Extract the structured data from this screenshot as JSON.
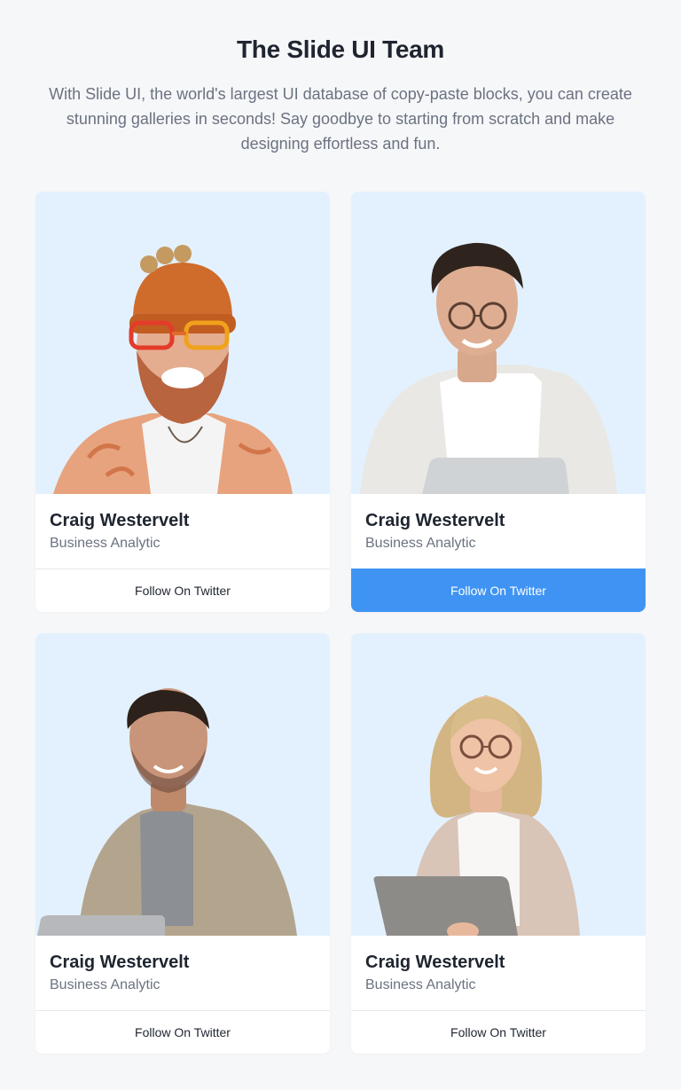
{
  "header": {
    "title": "The Slide UI Team",
    "subtitle": "With Slide UI, the world's largest UI database of copy-paste blocks, you can create stunning galleries in seconds! Say goodbye to starting from scratch and make designing effortless and fun."
  },
  "colors": {
    "page_background": "#f6f7f9",
    "photo_background": "#e3f1ff",
    "accent": "#3f94f3",
    "name_text": "#1f2530",
    "muted_text": "#6b7280"
  },
  "team": [
    {
      "name": "Craig Westervelt",
      "role": "Business Analytic",
      "button_label": "Follow On Twitter",
      "button_active": false,
      "photo": "man-beanie-orange-glasses-photo"
    },
    {
      "name": "Craig Westervelt",
      "role": "Business Analytic",
      "button_label": "Follow On Twitter",
      "button_active": true,
      "photo": "man-glasses-white-shirt-laptop-photo"
    },
    {
      "name": "Craig Westervelt",
      "role": "Business Analytic",
      "button_label": "Follow On Twitter",
      "button_active": false,
      "photo": "man-beige-jacket-laptop-photo"
    },
    {
      "name": "Craig Westervelt",
      "role": "Business Analytic",
      "button_label": "Follow On Twitter",
      "button_active": false,
      "photo": "woman-glasses-cardigan-laptop-photo"
    }
  ]
}
